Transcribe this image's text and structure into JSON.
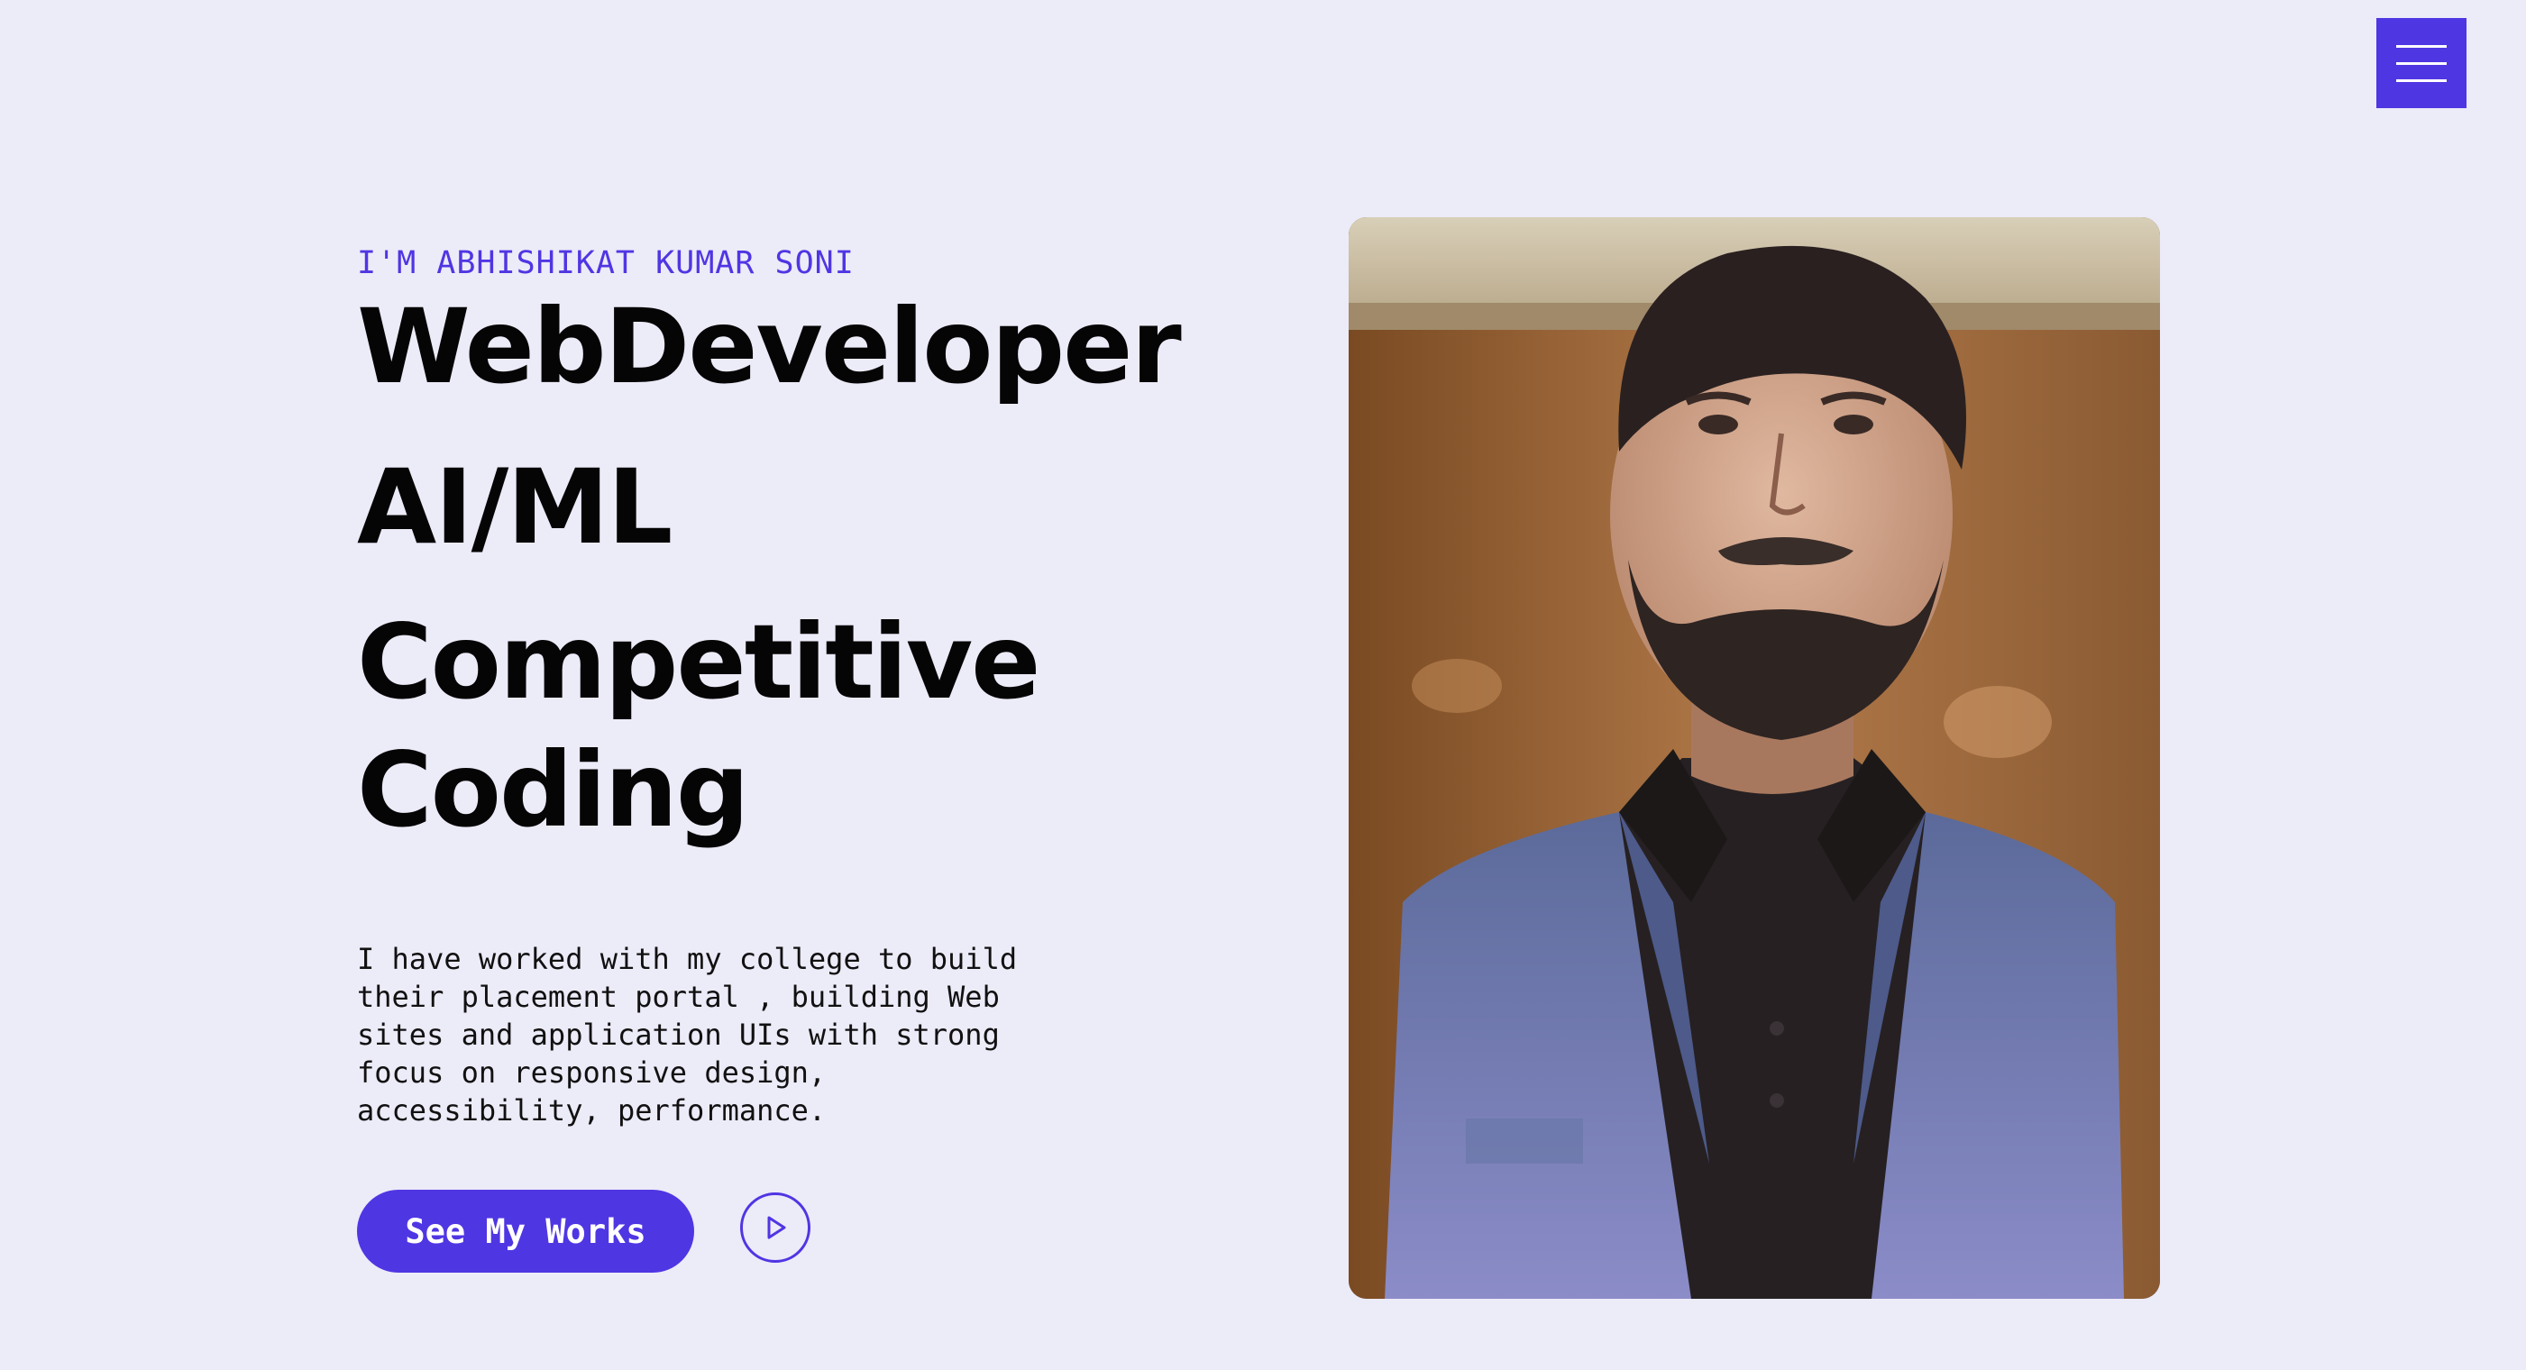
{
  "menu": {
    "icon": "hamburger-menu-icon"
  },
  "hero": {
    "intro": "I'M ABHISHIKAT KUMAR SONI",
    "headline_lines": [
      "WebDeveloper",
      "AI/ML",
      "Competitive",
      "Coding"
    ],
    "description": "I have worked with my college to build their placement portal , building Web sites and application UIs with strong focus on responsive design, accessibility, performance.",
    "cta_label": "See My Works",
    "play_icon": "play-icon"
  },
  "colors": {
    "accent": "#4f36e3",
    "background": "#ecebf8",
    "headline": "#050505"
  },
  "photo": {
    "alt": "portrait photo"
  }
}
